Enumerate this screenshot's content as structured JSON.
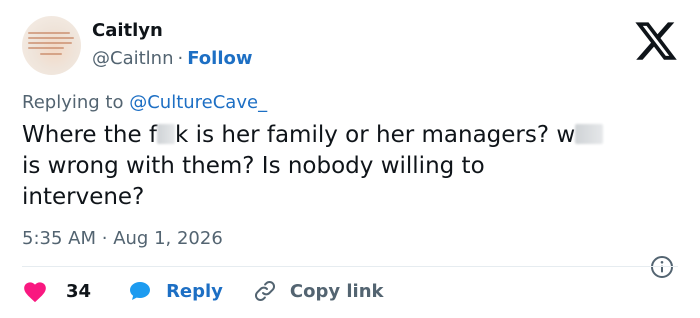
{
  "author": {
    "name": "Caitlyn",
    "handle": "@Caitlnn",
    "separator": "·",
    "follow_label": "Follow"
  },
  "reply_context": {
    "prefix": "Replying to",
    "mention": "@CultureCave_"
  },
  "tweet": {
    "line1_a": "Where the f",
    "line1_b": "k is her family or her managers? w",
    "line2": "is wrong with them? Is nobody willing to",
    "line3": "intervene?"
  },
  "timestamp": {
    "time": "5:35 AM",
    "separator": "·",
    "date": "Aug 1, 2026"
  },
  "actions": {
    "like_count": "34",
    "reply_label": "Reply",
    "copy_label": "Copy link"
  },
  "icons": {
    "brand": "x-logo-icon",
    "info": "info-icon",
    "like": "heart-icon",
    "reply": "speech-bubble-icon",
    "copy": "link-icon"
  },
  "colors": {
    "text": "#0f1419",
    "secondary": "#536471",
    "link": "#1d6fc4",
    "like": "#f91880",
    "divider": "#e6ecf0"
  }
}
